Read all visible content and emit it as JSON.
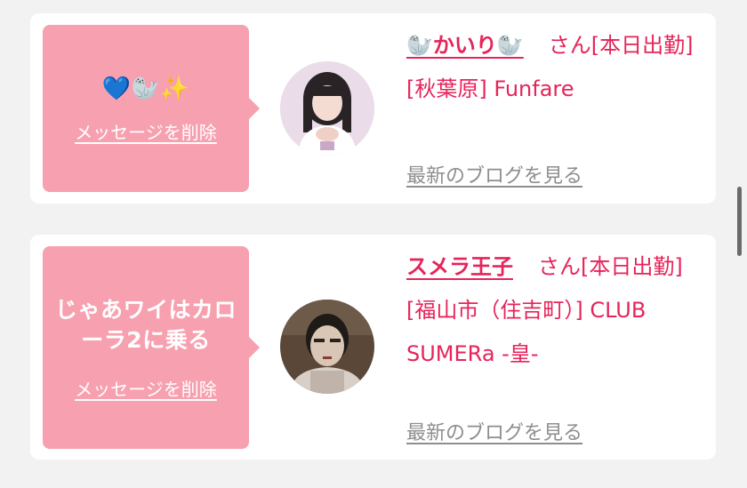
{
  "cards": [
    {
      "message": "💙🦭✨",
      "delete_label": "メッセージを削除",
      "name": "🦭かいり🦭",
      "san": "さん",
      "status": "[本日出勤]",
      "location": "[秋葉原] Funfare",
      "blog_label": "最新のブログを見る"
    },
    {
      "message": "じゃあワイはカローラ2に乗る",
      "delete_label": "メッセージを削除",
      "name": "スメラ王子",
      "san": "さん",
      "status": "[本日出勤]",
      "location": "[福山市（住吉町）] CLUB SUMERa -皇-",
      "blog_label": "最新のブログを見る"
    }
  ],
  "colors": {
    "bubble": "#f7a0b0",
    "accent": "#e6245a",
    "muted_link": "#8e8e8e",
    "background": "#f2f2f2"
  }
}
